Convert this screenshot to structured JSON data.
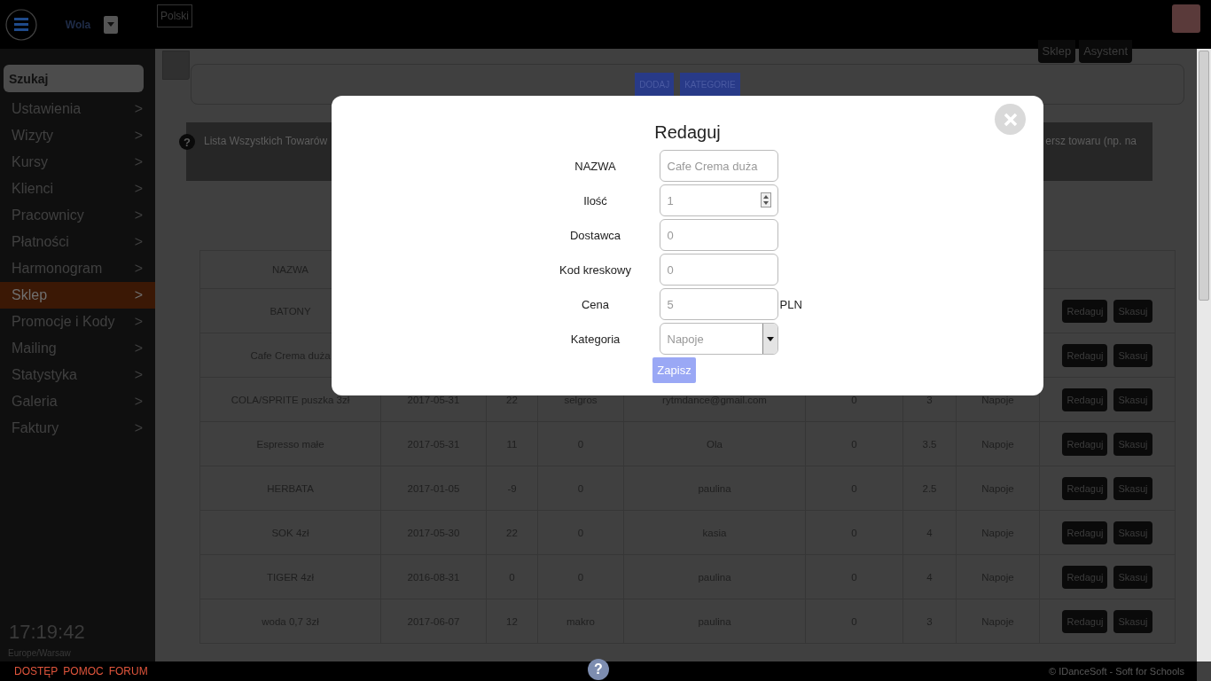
{
  "topbar": {
    "location": "Wola",
    "language": "Polski"
  },
  "sidebar": {
    "search": {
      "placeholder": "Szukaj"
    },
    "items": [
      {
        "label": "Ustawienia",
        "arrow": ">",
        "selected": false
      },
      {
        "label": "Wizyty",
        "arrow": ">",
        "selected": false
      },
      {
        "label": "Kursy",
        "arrow": ">",
        "selected": false
      },
      {
        "label": "Klienci",
        "arrow": ">",
        "selected": false
      },
      {
        "label": "Pracownicy",
        "arrow": ">",
        "selected": false
      },
      {
        "label": "Płatności",
        "arrow": ">",
        "selected": false
      },
      {
        "label": "Harmonogram",
        "arrow": ">",
        "selected": false
      },
      {
        "label": "Sklep",
        "arrow": ">",
        "selected": true
      },
      {
        "label": "Promocje i Kody",
        "arrow": ">",
        "selected": false
      },
      {
        "label": "Mailing",
        "arrow": ">",
        "selected": false
      },
      {
        "label": "Statystyka",
        "arrow": ">",
        "selected": false
      },
      {
        "label": "Galeria",
        "arrow": ">",
        "selected": false
      },
      {
        "label": "Faktury",
        "arrow": ">",
        "selected": false
      }
    ],
    "clock": "17:19:42",
    "timezone": "Europe/Warsaw"
  },
  "header_tabs": [
    "Sklep",
    "Asystent"
  ],
  "toolbar": {
    "buttons": [
      "DODAJ",
      "KATEGORIE"
    ]
  },
  "info": {
    "icon": "?",
    "text_start": "Lista Wszystkich Towarów",
    "text_end": "ersz towaru (np. na"
  },
  "table": {
    "columns": [
      "NAZWA"
    ],
    "rows": [
      {
        "cells": [
          "BATONY"
        ],
        "actions": [
          "Redaguj",
          "Skasuj"
        ]
      },
      {
        "cells": [
          "Cafe Crema duża"
        ],
        "actions": [
          "Redaguj",
          "Skasuj"
        ]
      },
      {
        "cells": [
          "COLA/SPRITE puszka 3zł",
          "2017-05-31",
          "22",
          "selgros",
          "rytmdance@gmail.com",
          "0",
          "3",
          "Napoje"
        ],
        "actions": [
          "Redaguj",
          "Skasuj"
        ]
      },
      {
        "cells": [
          "Espresso małe",
          "2017-05-31",
          "11",
          "0",
          "Ola",
          "0",
          "3.5",
          "Napoje"
        ],
        "actions": [
          "Redaguj",
          "Skasuj"
        ]
      },
      {
        "cells": [
          "HERBATA",
          "2017-01-05",
          "-9",
          "0",
          "paulina",
          "0",
          "2.5",
          "Napoje"
        ],
        "actions": [
          "Redaguj",
          "Skasuj"
        ]
      },
      {
        "cells": [
          "SOK 4zł",
          "2017-05-30",
          "22",
          "0",
          "kasia",
          "0",
          "4",
          "Napoje"
        ],
        "actions": [
          "Redaguj",
          "Skasuj"
        ]
      },
      {
        "cells": [
          "TIGER 4zł",
          "2016-08-31",
          "0",
          "0",
          "paulina",
          "0",
          "4",
          "Napoje"
        ],
        "actions": [
          "Redaguj",
          "Skasuj"
        ]
      },
      {
        "cells": [
          "woda 0,7 3zł",
          "2017-06-07",
          "12",
          "makro",
          "paulina",
          "0",
          "3",
          "Napoje"
        ],
        "actions": [
          "Redaguj",
          "Skasuj"
        ]
      }
    ]
  },
  "modal": {
    "title": "Redaguj",
    "fields": [
      {
        "label": "NAZWA",
        "value": "Cafe Crema duża",
        "kind": "text"
      },
      {
        "label": "Ilość",
        "value": "1",
        "kind": "number"
      },
      {
        "label": "Dostawca",
        "value": "0",
        "kind": "text"
      },
      {
        "label": "Kod kreskowy",
        "value": "0",
        "kind": "text"
      },
      {
        "label": "Cena",
        "value": "5",
        "unit": "PLN",
        "kind": "text"
      },
      {
        "label": "Kategoria",
        "value": "Napoje",
        "kind": "select"
      }
    ],
    "save": "Zapisz"
  },
  "footer": {
    "help": "?",
    "links": [
      "DOSTĘP",
      "POMOC",
      "FORUM"
    ],
    "copyright": "© IDanceSoft - Soft for Schools"
  }
}
